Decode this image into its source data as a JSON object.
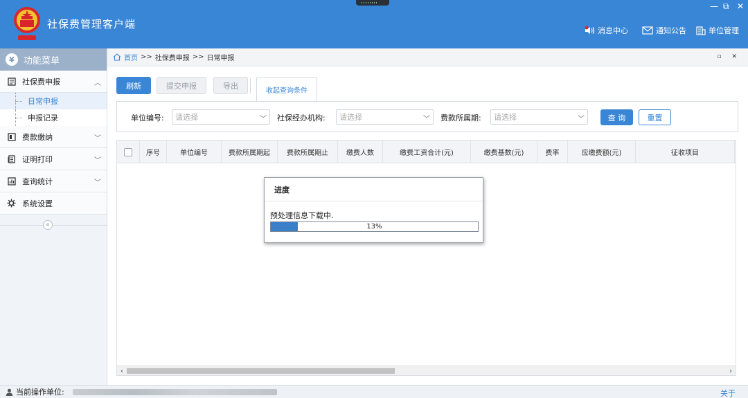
{
  "app": {
    "title": "社保费管理客户端"
  },
  "window_controls": {
    "minimize": "—",
    "restore": "⧉",
    "close": "✕"
  },
  "header_links": [
    {
      "label": "消息中心",
      "icon": "speaker-icon"
    },
    {
      "label": "通知公告",
      "icon": "envelope-icon"
    },
    {
      "label": "单位管理",
      "icon": "building-icon"
    }
  ],
  "sidebar": {
    "title": "功能菜单",
    "title_icon": "¥",
    "items": [
      {
        "label": "社保费申报",
        "icon": "clipboard-icon",
        "expanded": true,
        "sub": [
          {
            "label": "日常申报",
            "active": true
          },
          {
            "label": "申报记录",
            "active": false
          }
        ]
      },
      {
        "label": "费款缴纳",
        "icon": "wallet-icon",
        "expanded": false
      },
      {
        "label": "证明打印",
        "icon": "document-icon",
        "expanded": false
      },
      {
        "label": "查询统计",
        "icon": "chart-icon",
        "expanded": false
      },
      {
        "label": "系统设置",
        "icon": "gear-icon",
        "expanded": false
      }
    ],
    "collapse_glyph": "«"
  },
  "breadcrumb": {
    "home": "首页",
    "sep": ">>",
    "level1": "社保费申报",
    "level2": "日常申报",
    "ctrl_glyphs": "▫ ✕"
  },
  "toolbar": {
    "refresh": "刷新",
    "submit": "提交申报",
    "export": "导出",
    "toggle_query": "收起查询条件"
  },
  "query": {
    "unit_code_label": "单位编号:",
    "agency_label": "社保经办机构:",
    "period_label": "费款所属期:",
    "placeholder": "请选择",
    "search_button": "查 询",
    "reset_button": "重置"
  },
  "table": {
    "columns": [
      "序号",
      "单位编号",
      "费款所属期起",
      "费款所属期止",
      "缴费人数",
      "缴费工资合计(元)",
      "缴费基数(元)",
      "费率",
      "应缴费额(元)",
      "征收项目"
    ],
    "rows": []
  },
  "dialog": {
    "title": "进度",
    "message": "预处理信息下载中.",
    "progress_percent": 13,
    "progress_label": "13%"
  },
  "status": {
    "current_unit_label": "当前操作单位:",
    "about": "关于"
  },
  "colors": {
    "primary": "#3a86d6",
    "header": "#3a86d6",
    "sidebar_title": "#9bb0c9"
  }
}
